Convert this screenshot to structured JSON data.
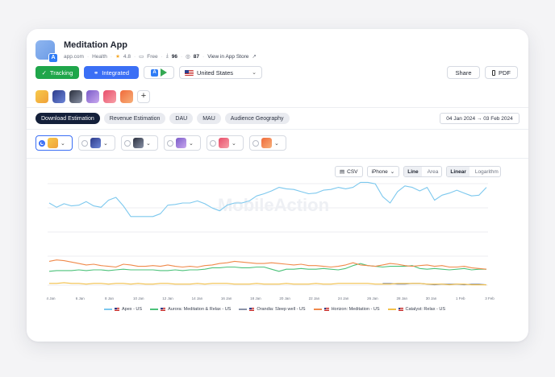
{
  "app": {
    "title": "Meditation App",
    "domain": "app.com",
    "category": "Health",
    "rating": "4.8",
    "price": "Free",
    "downloads_stat": "96",
    "views_stat": "87",
    "view_store": "View in App Store"
  },
  "toolbar": {
    "tracking_label": "Tracking",
    "integrated_label": "Integrated",
    "country": "United States",
    "share_label": "Share",
    "pdf_label": "PDF"
  },
  "tabs": [
    "Download Estimation",
    "Revenue Estimation",
    "DAU",
    "MAU",
    "Audience Geography"
  ],
  "date_range": "04 Jan 2024 → 03 Feb 2024",
  "chart_tools": {
    "csv_label": "CSV",
    "device": "iPhone",
    "line_label": "Line",
    "area_label": "Area",
    "linear_label": "Linear",
    "log_label": "Logarithm"
  },
  "colors": {
    "apex": "#7cc8ee",
    "aurora": "#4cc27a",
    "orandia": "#8a93a8",
    "horizon": "#f08a4b",
    "catalyst": "#f2c04a",
    "accent": "#3b6ff5",
    "tracking": "#1fa64a"
  },
  "swatch_colors": [
    [
      "#f7c94a",
      "#f0a13a"
    ],
    [
      "#2b3a8a",
      "#6d86d8"
    ],
    [
      "#2a2f3d",
      "#8a93a8"
    ],
    [
      "#7a5bc8",
      "#c9a8ef"
    ],
    [
      "#e84d6a",
      "#f7a0a8"
    ],
    [
      "#f06a3a",
      "#f7b07a"
    ]
  ],
  "watermark": "MobileAction",
  "chart_data": {
    "type": "line",
    "x_ticks": [
      "4 Jan",
      "6 Jan",
      "8 Jan",
      "10 Jan",
      "12 Jan",
      "14 Jan",
      "16 Jan",
      "18 Jan",
      "20 Jan",
      "22 Jan",
      "24 Jan",
      "26 Jan",
      "28 Jan",
      "30 Jan",
      "1 Feb",
      "3 Feb"
    ],
    "ylim": [
      0,
      100
    ],
    "grid": true,
    "legend_position": "bottom",
    "series": [
      {
        "name": "Apex - US",
        "key": "apex",
        "values": [
          58,
          52,
          57,
          54,
          55,
          60,
          54,
          52,
          62,
          66,
          54,
          39,
          39,
          39,
          39,
          43,
          55,
          56,
          58,
          58,
          61,
          57,
          51,
          47,
          55,
          58,
          58,
          61,
          68,
          71,
          75,
          80,
          78,
          77,
          74,
          71,
          72,
          76,
          77,
          80,
          78,
          80,
          87,
          87,
          85,
          67,
          58,
          74,
          82,
          80,
          75,
          80,
          62,
          69,
          72,
          76,
          72,
          68,
          69,
          80
        ]
      },
      {
        "name": "Aurora: Meditation & Relax - US",
        "key": "aurora",
        "values": [
          -38,
          -37,
          -37,
          -37,
          -36,
          -37,
          -36,
          -36,
          -37,
          -36,
          -35,
          -36,
          -36,
          -36,
          -36,
          -37,
          -37,
          -36,
          -37,
          -36,
          -36,
          -35,
          -33,
          -33,
          -32,
          -32,
          -33,
          -33,
          -32,
          -32,
          -35,
          -38,
          -35,
          -35,
          -34,
          -35,
          -35,
          -34,
          -35,
          -36,
          -34,
          -30,
          -27,
          -30,
          -31,
          -32,
          -31,
          -31,
          -31,
          -30,
          -34,
          -35,
          -34,
          -35,
          -36,
          -35,
          -34,
          -36,
          -35,
          -35
        ]
      },
      {
        "name": "Orandia: Sleep well - US",
        "key": "orandia",
        "values": [
          null,
          null,
          null,
          null,
          null,
          null,
          null,
          null,
          null,
          null,
          null,
          null,
          null,
          null,
          null,
          null,
          null,
          null,
          null,
          null,
          null,
          null,
          null,
          null,
          null,
          null,
          null,
          null,
          null,
          null,
          null,
          null,
          null,
          null,
          null,
          null,
          null,
          null,
          null,
          null,
          null,
          null,
          null,
          null,
          null,
          -55,
          -55,
          -56,
          -56,
          -55,
          -55,
          -56,
          -57,
          -56,
          -56,
          -56,
          -57,
          -56,
          -56,
          -57
        ]
      },
      {
        "name": "Horizon: Meditation - US",
        "key": "horizon",
        "values": [
          -24,
          -22,
          -23,
          -25,
          -27,
          -29,
          -28,
          -30,
          -31,
          -32,
          -28,
          -29,
          -31,
          -31,
          -30,
          -31,
          -29,
          -31,
          -32,
          -31,
          -32,
          -30,
          -29,
          -27,
          -26,
          -24,
          -25,
          -26,
          -27,
          -27,
          -26,
          -27,
          -28,
          -29,
          -28,
          -30,
          -30,
          -31,
          -32,
          -31,
          -29,
          -26,
          -29,
          -30,
          -31,
          -29,
          -27,
          -28,
          -30,
          -31,
          -30,
          -29,
          -31,
          -30,
          -32,
          -32,
          -31,
          -33,
          -34,
          -35
        ]
      },
      {
        "name": "Catalyst: Relax - US",
        "key": "catalyst",
        "values": [
          -55,
          -55,
          -54,
          -55,
          -55,
          -56,
          -55,
          -55,
          -56,
          -55,
          -55,
          -56,
          -55,
          -56,
          -56,
          -55,
          -55,
          -56,
          -56,
          -56,
          -55,
          -56,
          -55,
          -55,
          -55,
          -56,
          -56,
          -56,
          -55,
          -56,
          -56,
          -56,
          -55,
          -56,
          -56,
          -56,
          -55,
          -56,
          -56,
          -55,
          -55,
          -55,
          -55,
          -55,
          -56,
          -56,
          -56,
          -55,
          -55,
          -55,
          -55,
          -56,
          -56,
          -56,
          -57,
          -56,
          -56,
          -57,
          -57,
          -57
        ]
      }
    ]
  }
}
